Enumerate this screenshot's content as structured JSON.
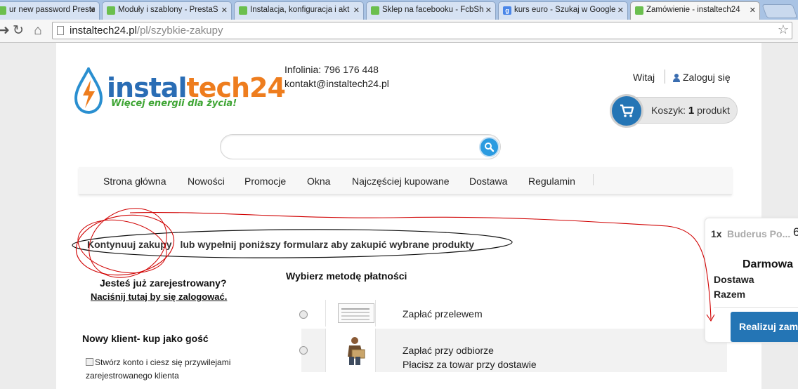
{
  "browser": {
    "tabs": [
      {
        "label": "ur new password PrestaS",
        "favicon": "prestashop-icon"
      },
      {
        "label": "Moduły i szablony - PrestaS",
        "favicon": "prestashop-icon"
      },
      {
        "label": "Instalacja, konfiguracja i akt",
        "favicon": "prestashop-icon"
      },
      {
        "label": "Sklep na facebooku - FcbSh",
        "favicon": "prestashop-icon"
      },
      {
        "label": "kurs euro - Szukaj w Google",
        "favicon": "google-icon",
        "favicon_letter": "g"
      },
      {
        "label": "Zamówienie - instaltech24",
        "favicon": "prestashop-icon",
        "active": true
      }
    ],
    "url_host": "instaltech24.pl",
    "url_path": "/pl/szybkie-zakupy"
  },
  "header": {
    "logo_part1": "instal",
    "logo_part2": "tech24",
    "logo_tagline": "Więcej energii dla życia!",
    "hotline": "Infolinia: 796 176 448",
    "contact_email": "kontakt@instaltech24.pl",
    "welcome": "Witaj",
    "login": "Zaloguj się",
    "cart_label": "Koszyk:",
    "cart_count": "1",
    "cart_unit": "produkt"
  },
  "search": {
    "placeholder": ""
  },
  "nav": {
    "items": [
      "Strona główna",
      "Nowości",
      "Promocje",
      "Okna",
      "Najczęściej kupowane",
      "Dostawa",
      "Regulamin"
    ]
  },
  "checkout": {
    "continue_link": "Kontynuuj zakupy",
    "continue_rest": "lub wypełnij poniższy formularz aby zakupić wybrane produkty",
    "registered_question": "Jesteś już zarejestrowany?",
    "login_link": "Naciśnij tutaj by się zalogować.",
    "guest_title": "Nowy klient- kup jako gość",
    "create_account_line1": "Stwórz konto i ciesz się przywilejami",
    "create_account_line2": "zarejestrowanego klienta",
    "payment_title": "Wybierz metodę płatności",
    "payment_methods": [
      {
        "label": "Zapłać przelewem",
        "image": "bank-transfer-icon"
      },
      {
        "label": "Zapłać przy odbiorze",
        "sub": "Płacisz za towar przy dostawie",
        "image": "courier-icon"
      }
    ]
  },
  "summary": {
    "qty": "1x",
    "product": "Buderus Po...",
    "price": "6",
    "free_shipping": "Darmowa",
    "shipping_label": "Dostawa",
    "total_label": "Razem",
    "order_button": "Realizuj zam"
  },
  "colors": {
    "brand_blue": "#2475b5",
    "brand_orange": "#ee7d1e",
    "brand_green": "#3fa535",
    "annotation_red": "#d00000"
  }
}
